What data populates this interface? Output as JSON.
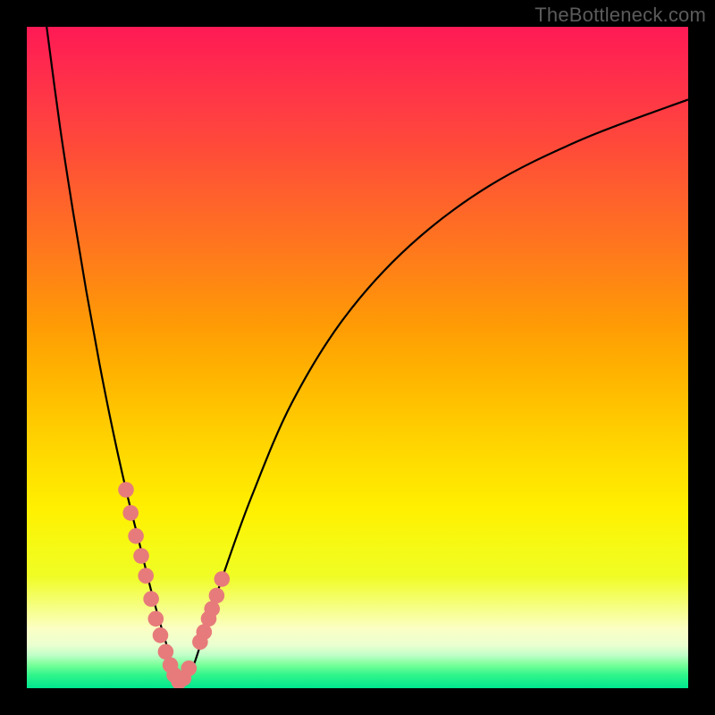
{
  "watermark": "TheBottleneck.com",
  "colors": {
    "frame": "#000000",
    "watermark_text": "#5b5b5b",
    "curve_stroke": "#000000",
    "marker_fill": "#e77b7b",
    "gradient_top": "#ff1a55",
    "gradient_bottom": "#00e68f"
  },
  "chart_data": {
    "type": "line",
    "title": "",
    "xlabel": "",
    "ylabel": "",
    "xlim": [
      0,
      100
    ],
    "ylim": [
      0,
      100
    ],
    "grid": false,
    "legend": false,
    "description": "V-shaped bottleneck curve over red-yellow-green vertical gradient. Minimum (0%) near x≈23. Left branch rises steeply toward 100% at x≈3; right branch rises and levels near 90% at x=100.",
    "series": [
      {
        "name": "bottleneck-curve",
        "x": [
          3,
          5,
          7,
          9,
          11,
          13,
          15,
          17,
          19,
          21,
          23,
          25,
          27,
          30,
          34,
          40,
          48,
          58,
          70,
          84,
          100
        ],
        "y": [
          100,
          85,
          72,
          60,
          49,
          39,
          30,
          22,
          14,
          7,
          1,
          3,
          9,
          18,
          29,
          43,
          56,
          67,
          76,
          83,
          89
        ]
      },
      {
        "name": "highlight-markers",
        "x": [
          15,
          15.7,
          16.5,
          17.3,
          18,
          18.8,
          19.5,
          20.2,
          21,
          21.7,
          22.3,
          23,
          23.7,
          24.5,
          26.2,
          26.8,
          27.5,
          28,
          28.7,
          29.5
        ],
        "y": [
          30,
          26.5,
          23,
          20,
          17,
          13.5,
          10.5,
          8,
          5.5,
          3.5,
          2,
          1,
          1.5,
          3,
          7,
          8.5,
          10.5,
          12,
          14,
          16.5
        ]
      }
    ]
  }
}
